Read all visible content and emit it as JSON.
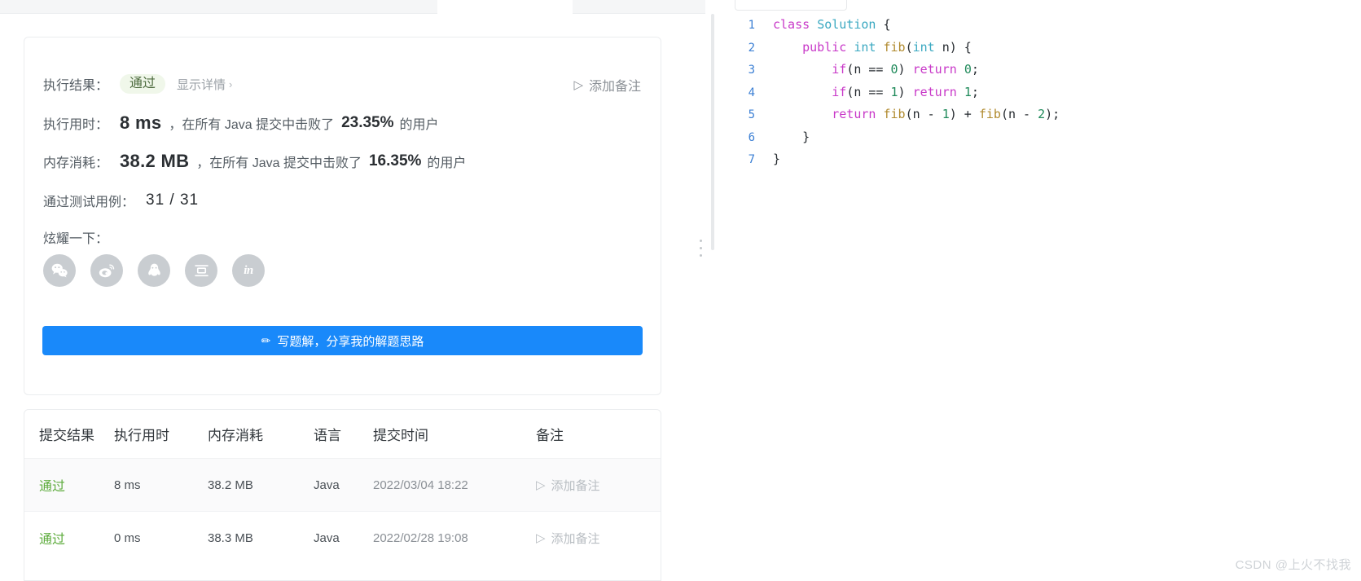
{
  "result_card": {
    "result_label": "执行结果：",
    "result_badge": "通过",
    "detail_link": "显示详情",
    "detail_chevron": "›",
    "add_note_label": "添加备注",
    "runtime_label": "执行用时：",
    "runtime_value": "8 ms",
    "runtime_mid": "，在所有 Java 提交中击败了",
    "runtime_pct": "23.35%",
    "runtime_suffix": "的用户",
    "memory_label": "内存消耗：",
    "memory_value": "38.2 MB",
    "memory_mid": "，在所有 Java 提交中击败了",
    "memory_pct": "16.35%",
    "memory_suffix": "的用户",
    "cases_label": "通过测试用例：",
    "cases_value": "31 / 31",
    "share_label": "炫耀一下：",
    "share_icons": [
      {
        "name": "wechat-share-icon",
        "label": "微信"
      },
      {
        "name": "weibo-share-icon",
        "label": "微博"
      },
      {
        "name": "qq-share-icon",
        "label": "QQ"
      },
      {
        "name": "douban-share-icon",
        "label": "豆瓣"
      },
      {
        "name": "linkedin-share-icon",
        "label": "in"
      }
    ],
    "write_button": "写题解，分享我的解题思路",
    "write_button_icon": "✏",
    "accent_color": "#1989fa",
    "pass_color": "#5cab3b"
  },
  "submissions": {
    "headers": [
      "提交结果",
      "执行用时",
      "内存消耗",
      "语言",
      "提交时间",
      "备注"
    ],
    "rows": [
      {
        "status": "通过",
        "runtime": "8 ms",
        "memory": "38.2 MB",
        "language": "Java",
        "time": "2022/03/04 18:22",
        "note": "添加备注"
      },
      {
        "status": "通过",
        "runtime": "0 ms",
        "memory": "38.3 MB",
        "language": "Java",
        "time": "2022/02/28 19:08",
        "note": "添加备注"
      }
    ]
  },
  "code": {
    "lines": [
      {
        "no": "1",
        "text": "class Solution {"
      },
      {
        "no": "2",
        "text": "    public int fib(int n) {"
      },
      {
        "no": "3",
        "text": "        if(n == 0) return 0;"
      },
      {
        "no": "4",
        "text": "        if(n == 1) return 1;"
      },
      {
        "no": "5",
        "text": "        return fib(n - 1) + fib(n - 2);"
      },
      {
        "no": "6",
        "text": "    }"
      },
      {
        "no": "7",
        "text": "}"
      }
    ]
  },
  "watermark": "CSDN @上火不找我"
}
